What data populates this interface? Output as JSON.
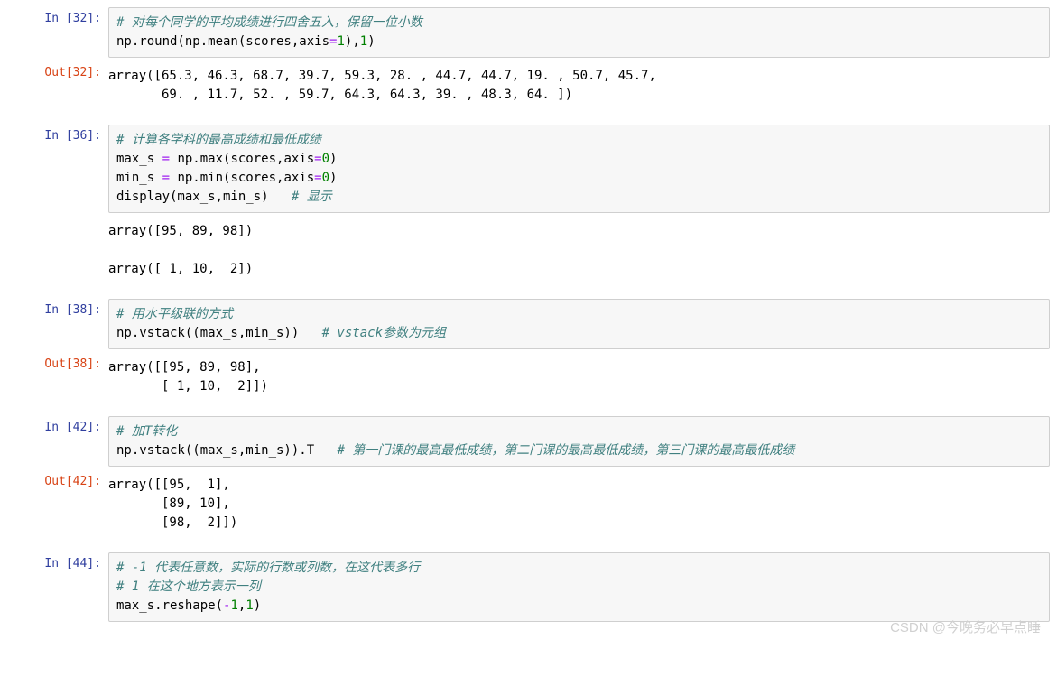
{
  "cells": [
    {
      "in_prompt": "In  [32]:",
      "code_html": "<span class='cm'># 对每个同学的平均成绩进行四舍五入，保留一位小数</span>\nnp.round(np.mean(scores,axis<span class='op'>=</span><span class='num'>1</span>),<span class='num'>1</span>)",
      "out_prompt": "Out[32]:",
      "output": "array([65.3, 46.3, 68.7, 39.7, 59.3, 28. , 44.7, 44.7, 19. , 50.7, 45.7,\n       69. , 11.7, 52. , 59.7, 64.3, 64.3, 39. , 48.3, 64. ])"
    },
    {
      "in_prompt": "In  [36]:",
      "code_html": "<span class='cm'># 计算各学科的最高成绩和最低成绩</span>\nmax_s <span class='op'>=</span> np.max(scores,axis<span class='op'>=</span><span class='num'>0</span>)\nmin_s <span class='op'>=</span> np.min(scores,axis<span class='op'>=</span><span class='num'>0</span>)\ndisplay(max_s,min_s)   <span class='cm'># 显示</span>",
      "out_prompt": "",
      "output": "array([95, 89, 98])\n\narray([ 1, 10,  2])"
    },
    {
      "in_prompt": "In  [38]:",
      "code_html": "<span class='cm'># 用水平级联的方式</span>\nnp.vstack((max_s,min_s))   <span class='cm'># vstack参数为元组</span>",
      "out_prompt": "Out[38]:",
      "output": "array([[95, 89, 98],\n       [ 1, 10,  2]])"
    },
    {
      "in_prompt": "In  [42]:",
      "code_html": "<span class='cm'># 加T转化</span>\nnp.vstack((max_s,min_s)).T   <span class='cm'># 第一门课的最高最低成绩，第二门课的最高最低成绩，第三门课的最高最低成绩</span>",
      "out_prompt": "Out[42]:",
      "output": "array([[95,  1],\n       [89, 10],\n       [98,  2]])"
    },
    {
      "in_prompt": "In  [44]:",
      "code_html": "<span class='cm'># -1 代表任意数，实际的行数或列数，在这代表多行</span>\n<span class='cm'># 1 在这个地方表示一列</span>\nmax_s.reshape(<span class='op'>-</span><span class='num'>1</span>,<span class='num'>1</span>)",
      "out_prompt": "",
      "output": ""
    }
  ],
  "watermark": "CSDN @今晚务必早点睡",
  "chart_data": {
    "type": "table",
    "notes": "numpy array outputs",
    "arrays": {
      "mean_rounded": [
        65.3,
        46.3,
        68.7,
        39.7,
        59.3,
        28.0,
        44.7,
        44.7,
        19.0,
        50.7,
        45.7,
        69.0,
        11.7,
        52.0,
        59.7,
        64.3,
        64.3,
        39.0,
        48.3,
        64.0
      ],
      "max_s": [
        95,
        89,
        98
      ],
      "min_s": [
        1,
        10,
        2
      ],
      "vstack": [
        [
          95,
          89,
          98
        ],
        [
          1,
          10,
          2
        ]
      ],
      "vstack_T": [
        [
          95,
          1
        ],
        [
          89,
          10
        ],
        [
          98,
          2
        ]
      ]
    }
  }
}
